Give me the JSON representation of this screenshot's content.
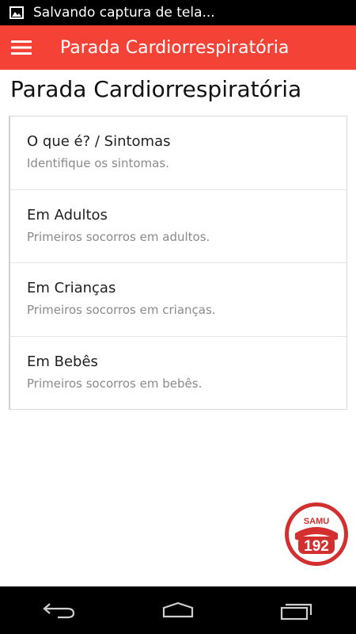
{
  "status_bar": {
    "notification_text": "Salvando captura de tela...",
    "icon": "image-icon"
  },
  "app_bar": {
    "title": "Parada Cardiorrespiratória",
    "menu_icon": "hamburger-menu-icon",
    "color": "#f44336"
  },
  "page": {
    "heading": "Parada Cardiorrespiratória"
  },
  "items": [
    {
      "title": "O que é? / Sintomas",
      "subtitle": "Identifique os sintomas."
    },
    {
      "title": "Em Adultos",
      "subtitle": "Primeiros socorros em adultos."
    },
    {
      "title": "Em Crianças",
      "subtitle": "Primeiros socorros em crianças."
    },
    {
      "title": "Em Bebês",
      "subtitle": "Primeiros socorros em bebês."
    }
  ],
  "samu_button": {
    "label": "SAMU",
    "number": "192",
    "icon": "phone-icon",
    "color": "#d32f2f"
  },
  "nav_bar": {
    "back_icon": "back-icon",
    "home_icon": "home-icon",
    "recents_icon": "recents-icon"
  }
}
